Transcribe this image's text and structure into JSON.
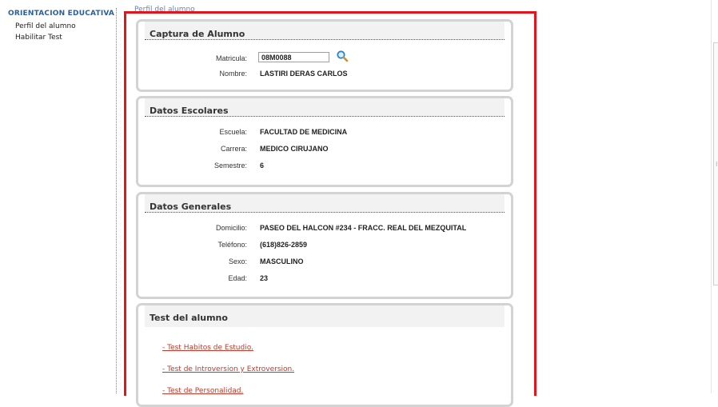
{
  "sidebar": {
    "title": "ORIENTACION EDUCATIVA",
    "items": [
      {
        "label": "Perfil del alumno"
      },
      {
        "label": "Habilitar Test"
      }
    ]
  },
  "main": {
    "legend": "Perfil del alumno",
    "captura": {
      "title": "Captura de Alumno",
      "matricula_label": "Matricula:",
      "matricula_value": "08M0088",
      "search_icon": "magnifier-icon",
      "nombre_label": "Nombre:",
      "nombre_value": "LASTIRI DERAS CARLOS"
    },
    "escolares": {
      "title": "Datos Escolares",
      "rows": [
        {
          "label": "Escuela:",
          "value": "FACULTAD DE MEDICINA"
        },
        {
          "label": "Carrera:",
          "value": "MEDICO CIRUJANO"
        },
        {
          "label": "Semestre:",
          "value": "6"
        }
      ]
    },
    "generales": {
      "title": "Datos Generales",
      "rows": [
        {
          "label": "Domicilio:",
          "value": "PASEO DEL HALCON #234 - FRACC. REAL DEL MEZQUITAL"
        },
        {
          "label": "Teléfono:",
          "value": "(618)826-2859"
        },
        {
          "label": "Sexo:",
          "value": "MASCULINO"
        },
        {
          "label": "Edad:",
          "value": "23"
        }
      ]
    },
    "tests": {
      "title": "Test del alumno",
      "links": [
        {
          "label": "- Test Habitos de Estudio."
        },
        {
          "label": "- Test de Introversion y Extroversion."
        },
        {
          "label": "- Test de Personalidad."
        }
      ]
    }
  },
  "colors": {
    "highlight_frame": "#e3141c",
    "sidebar_title": "#2a5f9e",
    "link": "#c0392b",
    "panel_border": "#d3d3d3"
  }
}
